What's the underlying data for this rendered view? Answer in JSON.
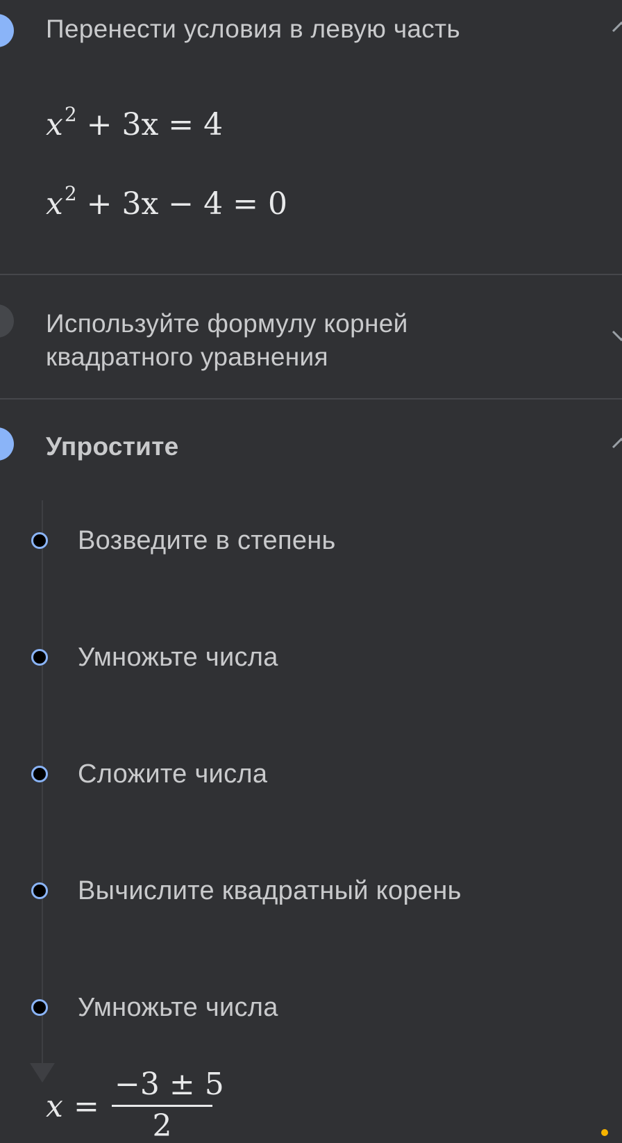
{
  "steps": [
    {
      "title": "Перенести условия в левую часть",
      "expanded": true,
      "circle_color": "#8ab4f8",
      "equations": [
        {
          "lhs_var": "x",
          "lhs_exp": "2",
          "rest": "+ 3x = 4"
        },
        {
          "lhs_var": "x",
          "lhs_exp": "2",
          "rest": "+ 3x − 4 = 0"
        }
      ]
    },
    {
      "title_line1": "Используйте формулу корней",
      "title_line2": "квадратного уравнения",
      "expanded": false,
      "circle_color": "#45474b"
    },
    {
      "title": "Упростите",
      "expanded": true,
      "circle_color": "#8ab4f8",
      "substeps": [
        {
          "label": "Возведите в степень"
        },
        {
          "label": "Умножьте числа"
        },
        {
          "label": "Сложите числа"
        },
        {
          "label": "Вычислите квадратный корень"
        },
        {
          "label": "Умножьте числа"
        }
      ]
    }
  ],
  "result": {
    "var": "x",
    "eq": "=",
    "numerator": "−3 ± 5",
    "denominator": "2"
  },
  "icons": {
    "expand": "chevron-up-icon",
    "collapse": "chevron-down-icon"
  },
  "colors": {
    "background": "#303134",
    "accent": "#8ab4f8",
    "text": "#c9cacc",
    "indicator": "#f6b400"
  }
}
